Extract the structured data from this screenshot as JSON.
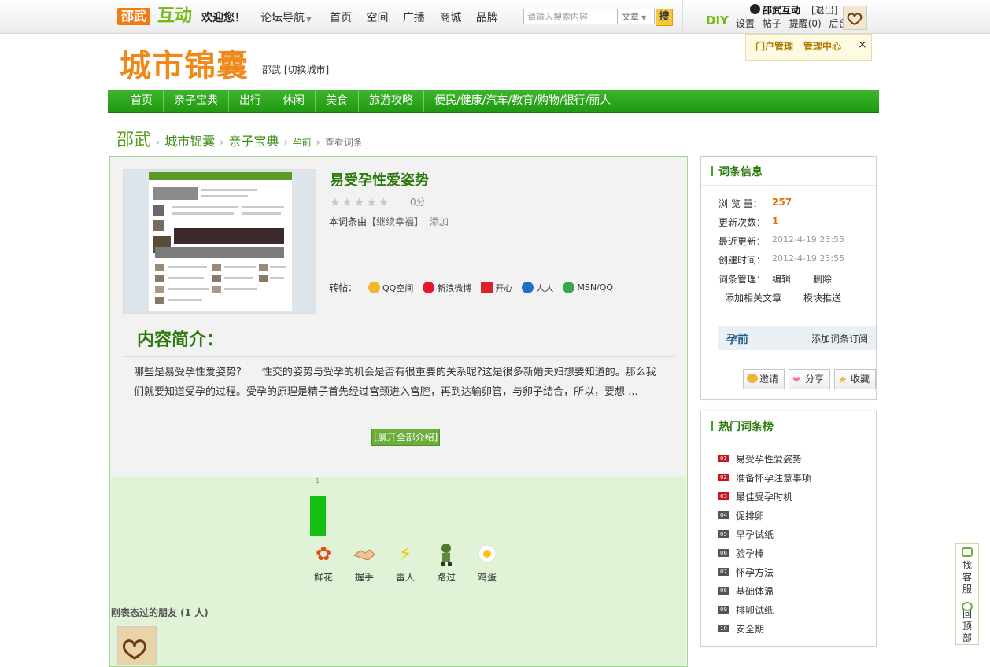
{
  "topbar": {
    "logo_city": "邵武",
    "logo_brand": "互动",
    "welcome": "欢迎您！",
    "forum_nav": "论坛导航",
    "nav": [
      "首页",
      "空间",
      "广播",
      "商城",
      "品牌"
    ],
    "search_placeholder": "请输入搜索内容",
    "search_type": "文章",
    "search_button": "搜",
    "diy": "DIY",
    "username": "邵武互动",
    "logout": "[退出]",
    "user_links": [
      "设置",
      "帖子",
      "提醒(0)",
      "后台"
    ]
  },
  "header": {
    "brand": "城市锦囊",
    "city": "邵武 [切换城市]",
    "admin_popup": {
      "portal": "门户管理",
      "center": "管理中心",
      "close": "×"
    }
  },
  "main_nav": [
    "首页",
    "亲子宝典",
    "出行",
    "休闲",
    "美食",
    "旅游攻略",
    "便民/健康/汽车/教育/购物/银行/丽人"
  ],
  "breadcrumb": [
    "邵武",
    "城市锦囊",
    "亲子宝典",
    "孕前",
    "查看词条"
  ],
  "entry": {
    "title": "易受孕性爱姿势",
    "stars": "★★★★★",
    "score": "0分",
    "creator_prefix": "本词条由",
    "creator_user": "【继续幸福】",
    "creator_suffix": "添加",
    "share_label": "转帖：",
    "share": [
      {
        "label": "QQ空间",
        "color": "#f1b82d"
      },
      {
        "label": "新浪微博",
        "color": "#e6162d"
      },
      {
        "label": "开心",
        "color": "#d8232a"
      },
      {
        "label": "人人",
        "color": "#1e6fc5"
      },
      {
        "label": "MSN/QQ",
        "color": "#3aa54a"
      }
    ],
    "intro_title": "内容简介：",
    "intro_text": "哪些是易受孕性爱姿势?　　性交的姿势与受孕的机会是否有很重要的关系呢?这是很多新婚夫妇想要知道的。那么我们就要知道受孕的过程。受孕的原理是精子首先经过宫颈进入宫腔，再到达输卵管，与卵子结合，所以，要想 ...",
    "expand": "[展开全部介绍]",
    "bar_count": "1",
    "moods": [
      {
        "label": "鲜花",
        "glyph": "✿",
        "color": "#e24b1b"
      },
      {
        "label": "握手",
        "glyph": "🤝",
        "color": "#e8a46a"
      },
      {
        "label": "雷人",
        "glyph": "⚡",
        "color": "#f3c400"
      },
      {
        "label": "路过",
        "glyph": "♞",
        "color": "#3f6d2a"
      },
      {
        "label": "鸡蛋",
        "glyph": "●",
        "color": "#f6c21a"
      }
    ],
    "visitors": "刚表态过的朋友 (1 人)"
  },
  "entry_info": {
    "title": "词条信息",
    "views_label": "浏 览 量：",
    "views": "257",
    "updates_label": "更新次数：",
    "updates": "1",
    "last_update_label": "最近更新：",
    "last_update": "2012-4-19 23:55",
    "created_label": "创建时间：",
    "created": "2012-4-19 23:55",
    "manage_label": "词条管理：",
    "edit": "编辑",
    "delete": "删除",
    "add_article": "添加相关文章",
    "push": "模块推送",
    "category": "孕前",
    "subscribe": "添加词条订阅",
    "invite": "邀请",
    "share": "分享",
    "favorite": "收藏"
  },
  "hot": {
    "title": "热门词条榜",
    "items": [
      {
        "n": "01",
        "label": "易受孕性爱姿势"
      },
      {
        "n": "02",
        "label": "准备怀孕注意事项"
      },
      {
        "n": "03",
        "label": "最佳受孕时机"
      },
      {
        "n": "04",
        "label": "促排卵"
      },
      {
        "n": "05",
        "label": "早孕试纸"
      },
      {
        "n": "06",
        "label": "验孕棒"
      },
      {
        "n": "07",
        "label": "怀孕方法"
      },
      {
        "n": "08",
        "label": "基础体温"
      },
      {
        "n": "09",
        "label": "排卵试纸"
      },
      {
        "n": "10",
        "label": "安全期"
      }
    ]
  },
  "float_side": {
    "service": "找客服",
    "top": "回顶部"
  }
}
